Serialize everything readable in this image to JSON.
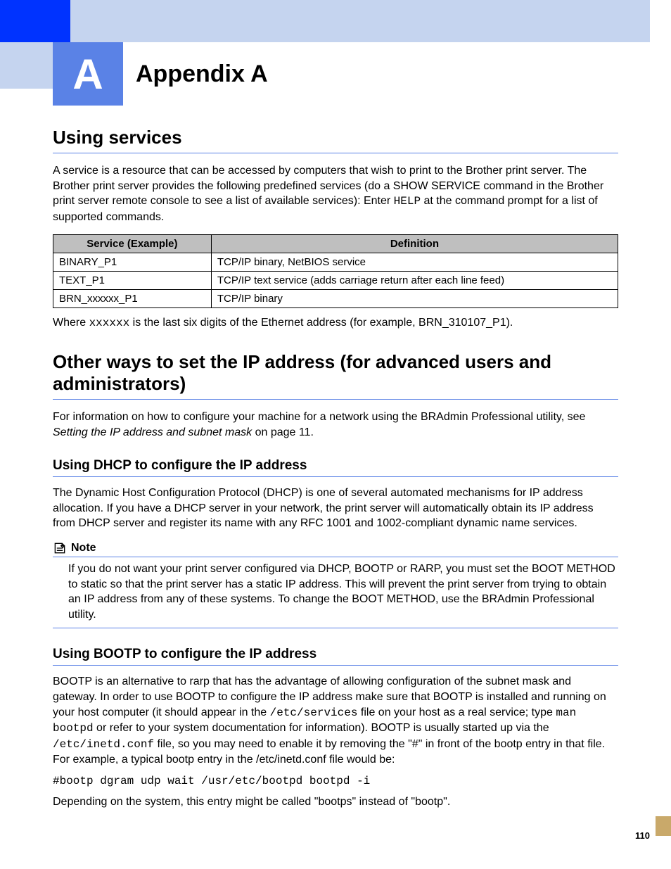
{
  "header": {
    "chapter_letter": "A",
    "chapter_title": "Appendix A"
  },
  "section1": {
    "title": "Using services",
    "intro_a": "A service is a resource that can be accessed by computers that wish to print to the Brother print server. The Brother print server provides the following predefined services (do a SHOW SERVICE command in the Brother print server remote console to see a list of available services): Enter ",
    "intro_code": "HELP",
    "intro_b": " at the command prompt for a list of supported commands.",
    "table": {
      "head": [
        "Service (Example)",
        "Definition"
      ],
      "rows": [
        [
          "BINARY_P1",
          "TCP/IP binary, NetBIOS service"
        ],
        [
          "TEXT_P1",
          "TCP/IP text service (adds carriage return after each line feed)"
        ],
        [
          "BRN_xxxxxx_P1",
          "TCP/IP binary"
        ]
      ]
    },
    "footnote_a": "Where ",
    "footnote_code": "xxxxxx",
    "footnote_b": " is the last six digits of the Ethernet address (for example, BRN_310107_P1)."
  },
  "section2": {
    "title": "Other ways to set the IP address (for advanced users and administrators)",
    "para_a": "For information on how to configure your machine for a network using the BRAdmin Professional utility, see ",
    "para_link": "Setting the IP address and subnet mask",
    "para_b": " on page 11."
  },
  "dhcp": {
    "title": "Using DHCP to configure the IP address",
    "para": "The Dynamic Host Configuration Protocol (DHCP) is one of several automated mechanisms for IP address allocation. If you have a DHCP server in your network, the print server will automatically obtain its IP address from DHCP server and register its name with any RFC 1001 and 1002-compliant dynamic name services.",
    "note_label": "Note",
    "note_body": "If you do not want your print server configured via DHCP, BOOTP or RARP, you must set the BOOT METHOD to static so that the print server has a static IP address. This will prevent the print server from trying to obtain an IP address from any of these systems. To change the BOOT METHOD, use the BRAdmin Professional utility."
  },
  "bootp": {
    "title": "Using BOOTP to configure the IP address",
    "p1a": "BOOTP is an alternative to rarp that has the advantage of allowing configuration of the subnet mask and gateway. In order to use BOOTP to configure the IP address make sure that BOOTP is installed and running on your host computer (it should appear in the ",
    "p1_code1": "/etc/services",
    "p1b": " file on your host as a real service; type ",
    "p1_code2": "man bootpd",
    "p1c": " or refer to your system documentation for information). BOOTP is usually started up via the ",
    "p1_code3": "/etc/inetd.conf",
    "p1d": " file, so you may need to enable it by removing the \"#\" in front of the bootp entry in that file. For example, a typical bootp entry in the /etc/inetd.conf file would be:",
    "code": "#bootp dgram udp wait /usr/etc/bootpd bootpd -i",
    "p2": "Depending on the system, this entry might be called \"bootps\" instead of \"bootp\"."
  },
  "page_number": "110"
}
